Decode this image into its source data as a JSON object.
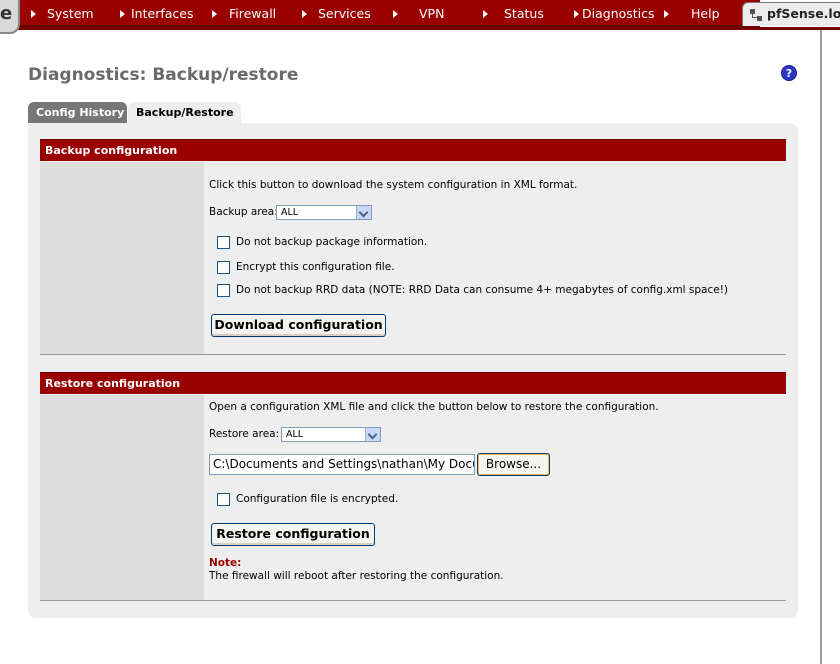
{
  "nav": {
    "logo_fragment": "e",
    "items": [
      "System",
      "Interfaces",
      "Firewall",
      "Services",
      "VPN",
      "Status",
      "Diagnostics",
      "Help"
    ],
    "hostname": "pfSense.loc"
  },
  "page": {
    "title": "Diagnostics: Backup/restore",
    "help_glyph": "?"
  },
  "tabs": [
    {
      "label": "Config History",
      "active": false
    },
    {
      "label": "Backup/Restore",
      "active": true
    }
  ],
  "backup": {
    "header": "Backup configuration",
    "description": "Click this button to download the system configuration in XML format.",
    "area_label": "Backup area:",
    "area_value": "ALL",
    "options": [
      {
        "label": "Do not backup package information.",
        "checked": false
      },
      {
        "label": "Encrypt this configuration file.",
        "checked": false
      },
      {
        "label": "Do not backup RRD data (NOTE: RRD Data can consume 4+ megabytes of config.xml space!)",
        "checked": false
      }
    ],
    "button": "Download configuration"
  },
  "restore": {
    "header": "Restore configuration",
    "description": "Open a configuration XML file and click the button below to restore the configuration.",
    "area_label": "Restore area:",
    "area_value": "ALL",
    "file_value": "C:\\Documents and Settings\\nathan\\My Docu",
    "browse_label": "Browse...",
    "encrypted_label": "Configuration file is encrypted.",
    "encrypted_checked": false,
    "button": "Restore configuration",
    "note_label": "Note:",
    "note_text": "The firewall will reboot after restoring the configuration."
  },
  "colors": {
    "accent_red": "#9b0000",
    "panel_bg": "#eeeeee",
    "left_col_bg": "#dddddd",
    "inactive_tab": "#777777",
    "help_blue": "#2b35c8"
  }
}
